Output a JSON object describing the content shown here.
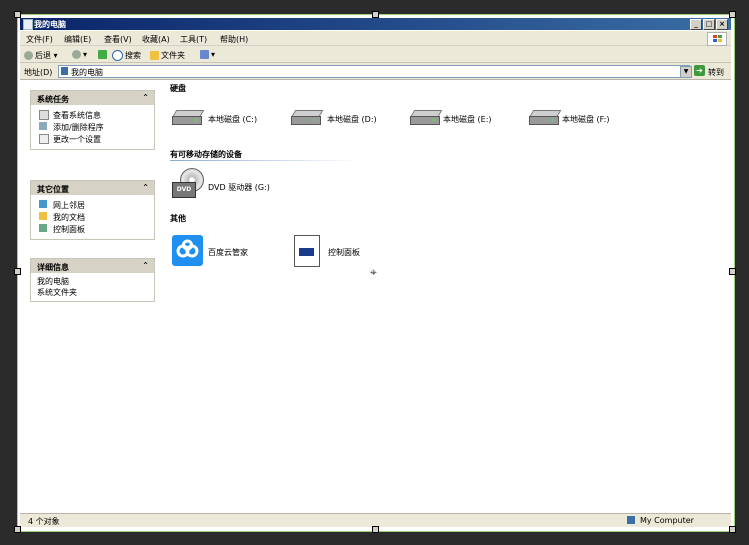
{
  "window": {
    "title": "我的电脑",
    "min": "_",
    "max": "□",
    "close": "×"
  },
  "menu": [
    "文件(F)",
    "编辑(E)",
    "查看(V)",
    "收藏(A)",
    "工具(T)",
    "帮助(H)"
  ],
  "toolbar": {
    "back": "后退",
    "search": "搜索",
    "folders": "文件夹"
  },
  "address": {
    "label": "地址(D)",
    "value": "我的电脑",
    "go": "转到"
  },
  "sidebar": {
    "system_tasks": {
      "title": "系统任务",
      "items": [
        "查看系统信息",
        "添加/删除程序",
        "更改一个设置"
      ]
    },
    "other_places": {
      "title": "其它位置",
      "items": [
        "网上邻居",
        "我的文档",
        "控制面板"
      ]
    },
    "details": {
      "title": "详细信息",
      "line1": "我的电脑",
      "line2": "系统文件夹"
    }
  },
  "sections": {
    "disks": "硬盘",
    "removable": "有可移动存储的设备",
    "other": "其他"
  },
  "drives": [
    "本地磁盘 (C:)",
    "本地磁盘 (D:)",
    "本地磁盘 (E:)",
    "本地磁盘 (F:)"
  ],
  "removable_items": [
    "DVD 驱动器 (G:)"
  ],
  "other_items": [
    "百度云管家",
    "控制面板"
  ],
  "status": {
    "left": "4 个对象",
    "right": "My Computer"
  }
}
